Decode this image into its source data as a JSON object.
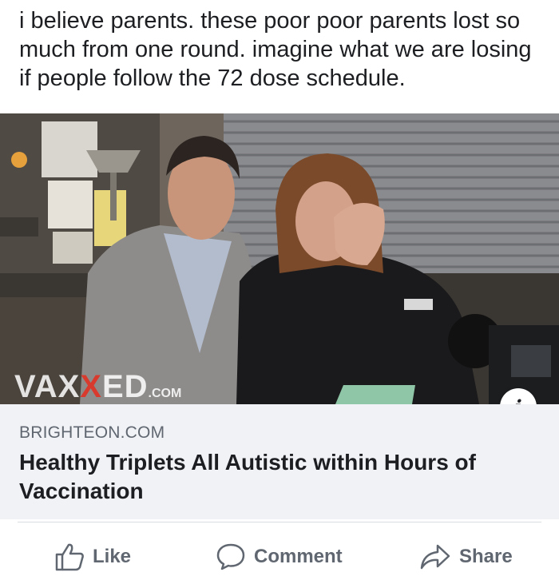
{
  "post": {
    "text": "i believe parents.  these poor poor parents lost so much from one round.  imagine what we are losing if people follow the 72 dose schedule."
  },
  "link_preview": {
    "watermark_main": "VAX",
    "watermark_accent": "X",
    "watermark_rest": "ED",
    "watermark_suffix": ".COM",
    "info_icon": "i",
    "domain": "BRIGHTEON.COM",
    "title": "Healthy Triplets All Autistic within Hours of Vaccination"
  },
  "actions": {
    "like_label": "Like",
    "comment_label": "Comment",
    "share_label": "Share"
  },
  "colors": {
    "text_primary": "#1c1e21",
    "text_secondary": "#606770",
    "card_background": "#f0f2f5",
    "watermark_accent": "#d83a2e"
  }
}
